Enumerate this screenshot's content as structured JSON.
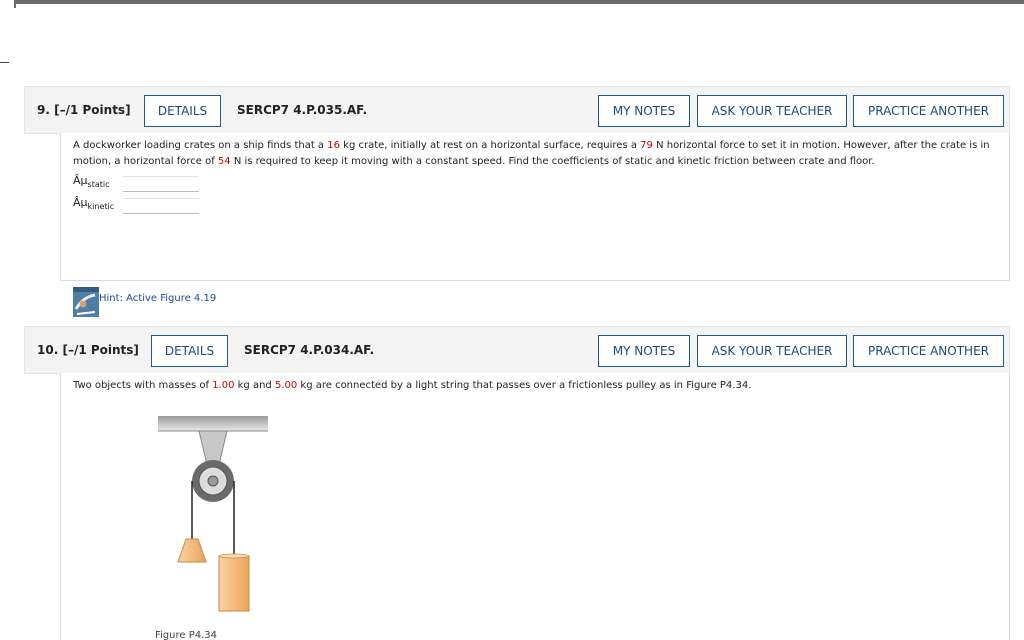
{
  "colors": {
    "accent": "#1a5c8e",
    "highlight_number": "#c00000",
    "header_bg": "#f3f3f3"
  },
  "questions": [
    {
      "number": "9.",
      "points": "[–/1 Points]",
      "details_label": "DETAILS",
      "code": "SERCP7 4.P.035.AF.",
      "my_notes_label": "MY NOTES",
      "ask_teacher_label": "ASK YOUR TEACHER",
      "practice_label": "PRACTICE ANOTHER",
      "text": {
        "t1": "A dockworker loading crates on a ship finds that a ",
        "mass": "16",
        "t2": " kg crate, initially at rest on a horizontal surface, requires a ",
        "force1": "79",
        "t3": " N horizontal force to set it in motion. However, after the crate is in motion, a horizontal force of ",
        "force2": "54",
        "t4": " N is required to keep it moving with a constant speed. Find the coefficients of static and kinetic friction between crate and floor."
      },
      "answers": [
        {
          "symbol": "Âµ",
          "subscript": "static",
          "value": ""
        },
        {
          "symbol": "Âµ",
          "subscript": "kinetic",
          "value": ""
        }
      ],
      "hint": {
        "label": "Hint: Active Figure 4.19",
        "icon": "hint-figure-thumbnail-icon"
      }
    },
    {
      "number": "10.",
      "points": "[–/1 Points]",
      "details_label": "DETAILS",
      "code": "SERCP7 4.P.034.AF.",
      "my_notes_label": "MY NOTES",
      "ask_teacher_label": "ASK YOUR TEACHER",
      "practice_label": "PRACTICE ANOTHER",
      "text": {
        "t1": "Two objects with masses of ",
        "m1": "1.00",
        "t2": " kg and ",
        "m2": "5.00",
        "t3": " kg are connected by a light string that passes over a frictionless pulley as in Figure P4.34."
      },
      "figure": {
        "caption": "Figure P4.34",
        "icon": "pulley-figure"
      }
    }
  ]
}
